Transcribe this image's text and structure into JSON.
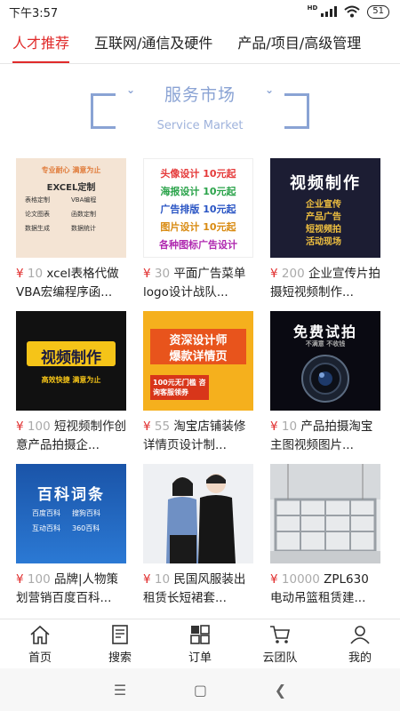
{
  "status": {
    "time": "下午3:57",
    "network": "HD",
    "battery": "51"
  },
  "tabs": [
    {
      "label": "人才推荐",
      "active": true
    },
    {
      "label": "互联网/通信及硬件",
      "active": false
    },
    {
      "label": "产品/项目/高级管理",
      "active": false
    }
  ],
  "hero": {
    "title": "服务市场",
    "subtitle": "Service Market"
  },
  "products": [
    {
      "currency": "¥",
      "price": "10",
      "title": "xcel表格代做VBA宏编程序函...",
      "art": {
        "head": "专业耐心  满意为止",
        "name": "EXCEL定制",
        "items": [
          "表格定制",
          "VBA编程",
          "论文图表",
          "函数定制",
          "数据生成",
          "数据统计"
        ]
      }
    },
    {
      "currency": "¥",
      "price": "30",
      "title": "平面广告菜单logo设计战队...",
      "art": {
        "lines": [
          "头像设计 10元起",
          "海报设计 10元起",
          "广告排版 10元起",
          "图片设计 10元起",
          "各种图标广告设计"
        ]
      }
    },
    {
      "currency": "¥",
      "price": "200",
      "title": "企业宣传片拍摄短视频制作...",
      "art": {
        "head": "视频制作",
        "lines": [
          "企业宣传",
          "产品广告",
          "短视频拍",
          "活动现场"
        ]
      }
    },
    {
      "currency": "¥",
      "price": "100",
      "title": "短视频制作创意产品拍摄企...",
      "art": {
        "head": "视频制作",
        "sub": "高效快捷 满意为止"
      }
    },
    {
      "currency": "¥",
      "price": "55",
      "title": "淘宝店铺装修详情页设计制...",
      "art": {
        "head": "资深设计师",
        "mid": "爆款详情页",
        "foot": "100元无门槛 咨询客服领券"
      }
    },
    {
      "currency": "¥",
      "price": "10",
      "title": "产品拍摄淘宝主图视频图片...",
      "art": {
        "head": "免费试拍",
        "sub": "不满意 不收钱"
      }
    },
    {
      "currency": "¥",
      "price": "100",
      "title": "品牌|人物策划营销百度百科...",
      "art": {
        "head": "百科词条",
        "lines": [
          "百度百科",
          "搜狗百科",
          "互动百科",
          "360百科"
        ]
      }
    },
    {
      "currency": "¥",
      "price": "10",
      "title": "民国风服装出租赁长短裙套...",
      "art": {}
    },
    {
      "currency": "¥",
      "price": "10000",
      "title": "ZPL630电动吊篮租赁建...",
      "art": {}
    }
  ],
  "nav": [
    {
      "label": "首页",
      "icon": "home-icon"
    },
    {
      "label": "搜索",
      "icon": "search-doc-icon"
    },
    {
      "label": "订单",
      "icon": "grid-icon"
    },
    {
      "label": "云团队",
      "icon": "cart-icon"
    },
    {
      "label": "我的",
      "icon": "user-icon"
    }
  ],
  "colors": {
    "accent": "#e02a2a",
    "hero": "#8aa3d4"
  }
}
